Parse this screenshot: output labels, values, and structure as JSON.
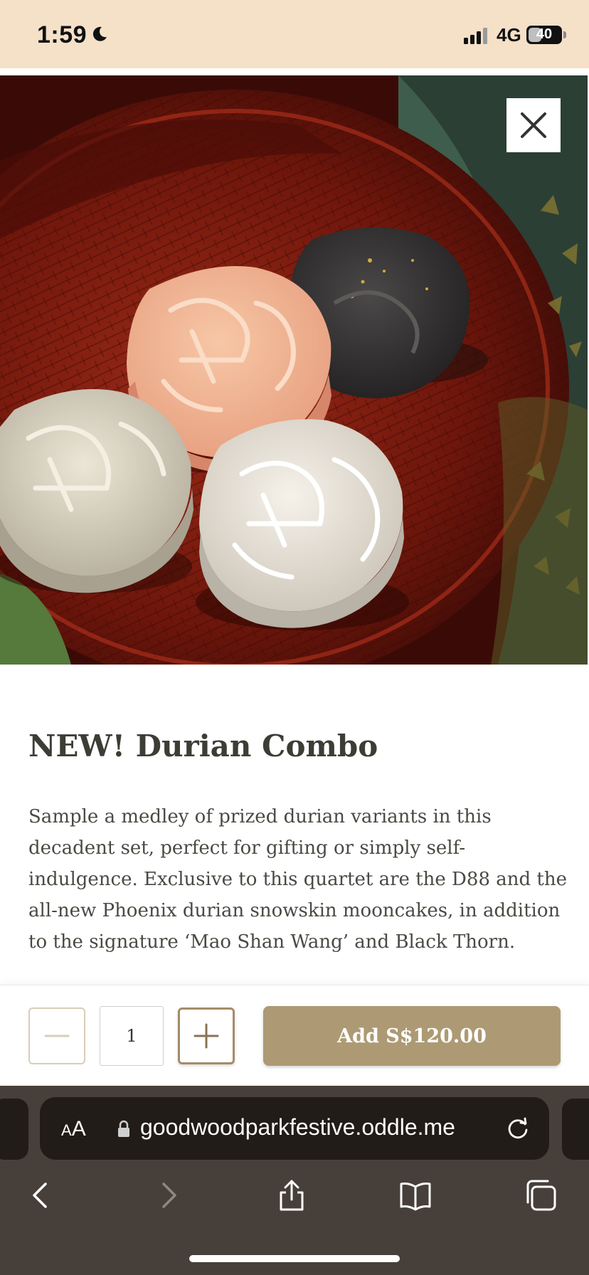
{
  "status_bar": {
    "time": "1:59",
    "network": "4G",
    "battery": "40",
    "battery_level": 0.4
  },
  "hero": {
    "close_icon": "close-icon"
  },
  "product": {
    "title": "NEW! Durian Combo",
    "description": "Sample a medley of prized durian variants in this decadent set, perfect for gifting or simply self-indulgence. Exclusive to this quartet are the D88 and the all-new Phoenix durian snowskin mooncakes, in addition to the signature ‘Mao Shan Wang’ and Black Thorn."
  },
  "cart": {
    "quantity": "1",
    "add_label": "Add S$120.00",
    "accent": "#ad9a74"
  },
  "browser": {
    "aa_small": "A",
    "aa_big": "A",
    "url": "goodwoodparkfestive.oddle.me"
  }
}
